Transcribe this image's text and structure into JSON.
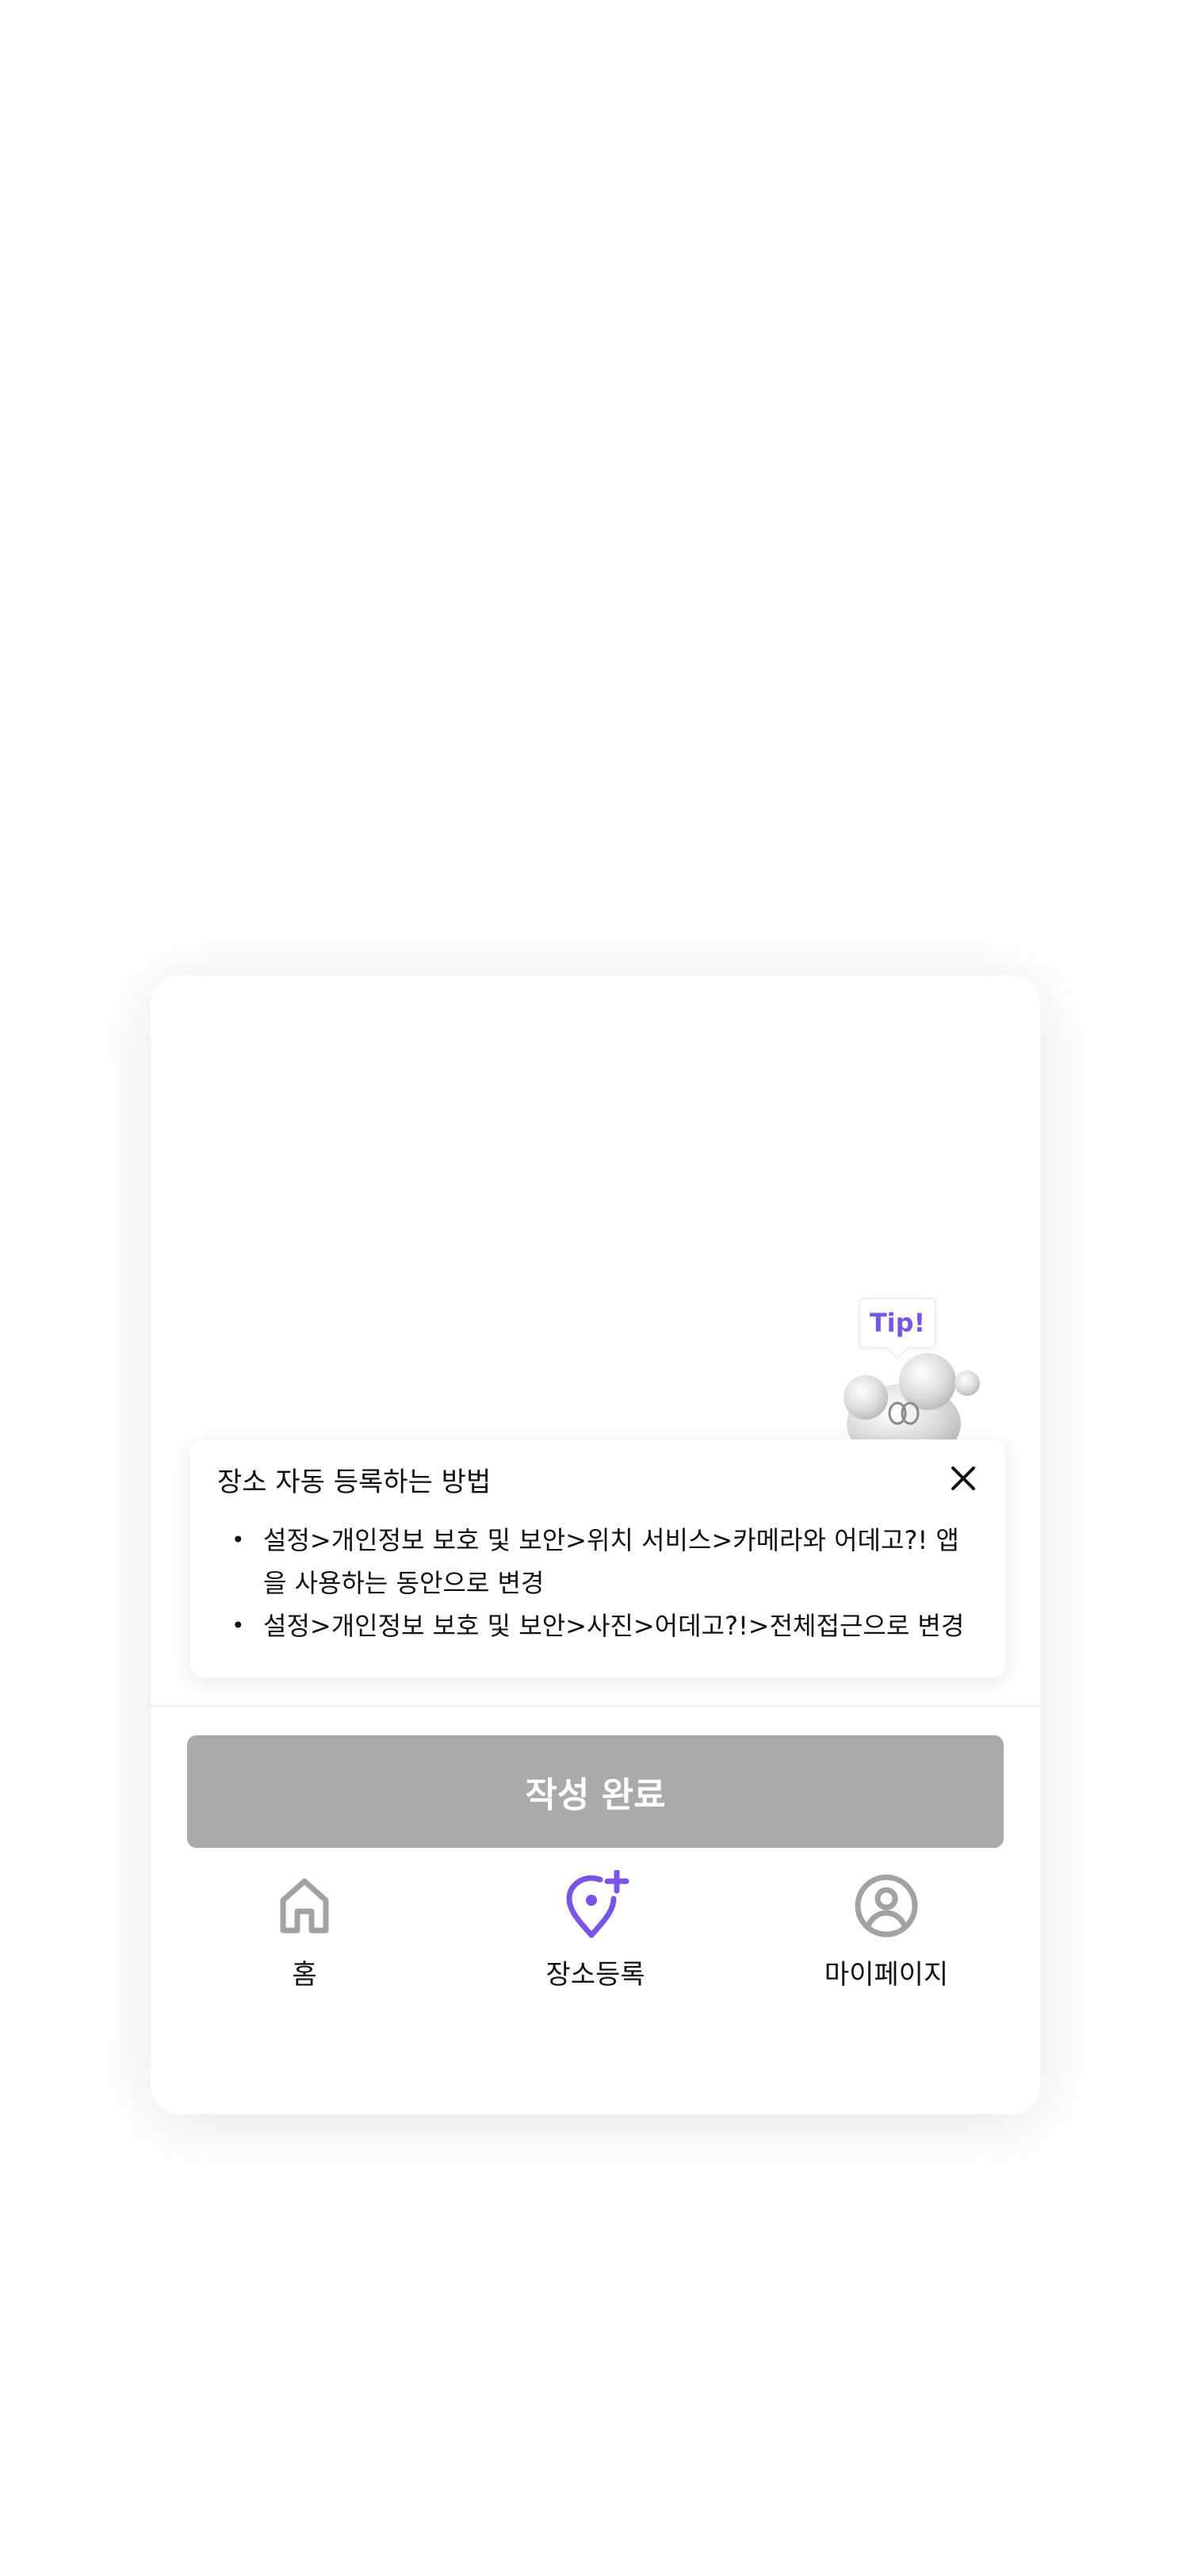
{
  "tip": {
    "badge": "Tip!",
    "title": "장소 자동 등록하는 방법",
    "items": [
      "설정>개인정보 보호 및 보안>위치 서비스>카메라와 어데고?! 앱을 사용하는 동안으로 변경",
      "설정>개인정보 보호 및 보안>사진>어데고?!>전체접근으로 변경"
    ],
    "close_icon": "close-icon"
  },
  "actions": {
    "submit_label": "작성 완료"
  },
  "tabbar": {
    "items": [
      {
        "label": "홈",
        "icon": "home-icon",
        "active": false
      },
      {
        "label": "장소등록",
        "icon": "location-add-icon",
        "active": true
      },
      {
        "label": "마이페이지",
        "icon": "user-circle-icon",
        "active": false
      }
    ]
  },
  "colors": {
    "accent": "#7b55e6",
    "disabled_button": "#a9aaaa",
    "inactive_icon": "#a2a2a2"
  }
}
